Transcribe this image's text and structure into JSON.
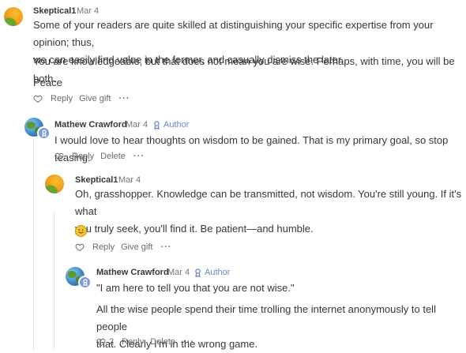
{
  "comments": [
    {
      "author": "Skeptical1",
      "date": "Mar 4",
      "paragraphs": [
        "Some of your readers are quite skilled at distinguishing your specific expertise from your opinion; thus,",
        "we can easily find value in the former, and casually dismiss the later.",
        "You are knowledgeable, but that does not mean you are wise. Perhaps, with time, you will be both.",
        "Peace"
      ],
      "actions": {
        "reply": "Reply",
        "gift": "Give gift",
        "more": "···"
      }
    },
    {
      "author": "Mathew Crawford",
      "date": "Mar 4",
      "author_badge": "Author",
      "paragraphs": [
        "I would love to hear thoughts on wisdom to be gained. That is my primary goal, so stop teasing."
      ],
      "actions": {
        "reply": "Reply",
        "delete": "Delete",
        "more": "···"
      }
    },
    {
      "author": "Skeptical1",
      "date": "Mar 4",
      "paragraphs": [
        "Oh, grasshopper. Knowledge can be transmitted, not wisdom. You're still young. If it's what",
        "you truly seek, you'll find it. Be patient—and humble."
      ],
      "emoji": "smiley-emoji",
      "actions": {
        "reply": "Reply",
        "gift": "Give gift",
        "more": "···"
      }
    },
    {
      "author": "Mathew Crawford",
      "date": "Mar 4",
      "author_badge": "Author",
      "paragraphs": [
        "\"I am here to tell you that you are not wise.\"",
        "All the wise people spend their time trolling the internet anonymously to tell people",
        "that. Clearly I'm in the wrong game."
      ],
      "actions": {
        "likes": "2",
        "reply": "Reply",
        "delete": "Delete",
        "more": "···"
      }
    }
  ],
  "colors": {
    "author_badge": "#6b85c8",
    "thread_line": "#e3e3e3"
  },
  "icons": [
    "heart-icon",
    "author-crest-icon",
    "avatar-badge-icon"
  ]
}
